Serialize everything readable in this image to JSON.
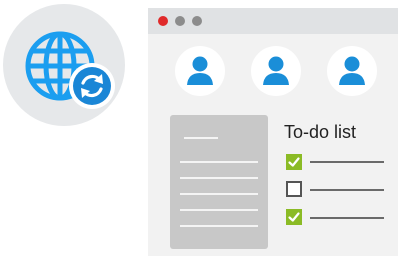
{
  "colors": {
    "globe": "#1b9ef0",
    "sync_badge": "#1a86d6",
    "avatar_blue": "#1a8ed8",
    "check_green": "#8bbb25",
    "close_dot": "#e02a2a",
    "window_bg": "#f2f2f2",
    "titlebar_bg": "#e0e2e4"
  },
  "globe": {
    "icon": "globe-icon",
    "badge_icon": "sync-icon"
  },
  "window": {
    "controls": [
      "close",
      "minimize",
      "maximize"
    ],
    "avatars": [
      "user-icon",
      "user-icon",
      "user-icon"
    ]
  },
  "todo": {
    "title": "To-do list",
    "items": [
      {
        "checked": true
      },
      {
        "checked": false
      },
      {
        "checked": true
      }
    ]
  }
}
